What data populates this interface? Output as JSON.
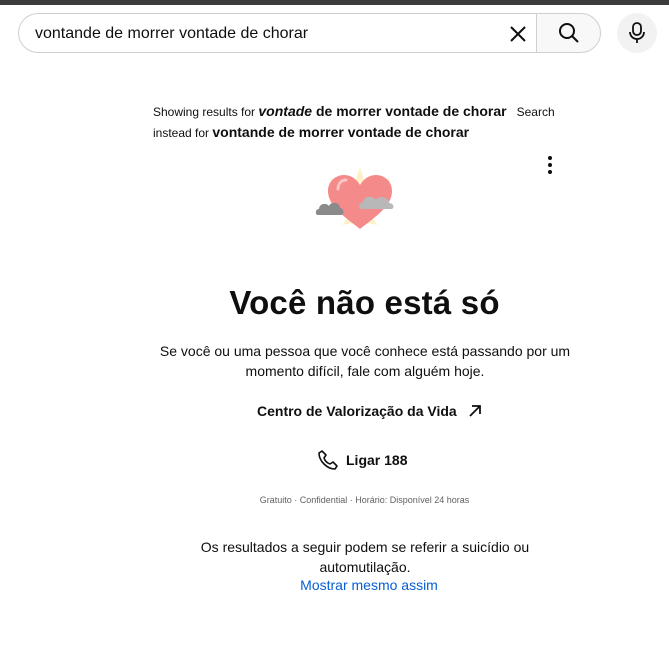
{
  "search": {
    "query": "vontande de morrer vontade de chorar",
    "clear_icon": "close-icon",
    "search_icon": "search-icon",
    "mic_icon": "microphone-icon"
  },
  "spelling": {
    "showing_prefix": "Showing results for ",
    "corrected_italic": "vontade",
    "corrected_rest": " de morrer vontade de chorar",
    "search_instead_prefix": "Search instead for ",
    "original_query": "vontande de morrer vontade de chorar"
  },
  "crisis_panel": {
    "menu_icon": "more-vert-icon",
    "illustration": "heart-with-clouds-icon",
    "title": "Você não está só",
    "message": "Se você ou uma pessoa que você conhece está passando por um momento difícil, fale com alguém hoje.",
    "org_link": "Centro de Valorização da Vida",
    "call_label": "Ligar 188",
    "availability": "Gratuito · Confidential · Horário: Disponível 24 horas"
  },
  "warning": {
    "text": "Os resultados a seguir podem se referir a suicídio ou automutilação.",
    "show_anyway": "Mostrar mesmo assim"
  },
  "colors": {
    "link_blue": "#065fd4",
    "heart": "#f48a8a"
  }
}
